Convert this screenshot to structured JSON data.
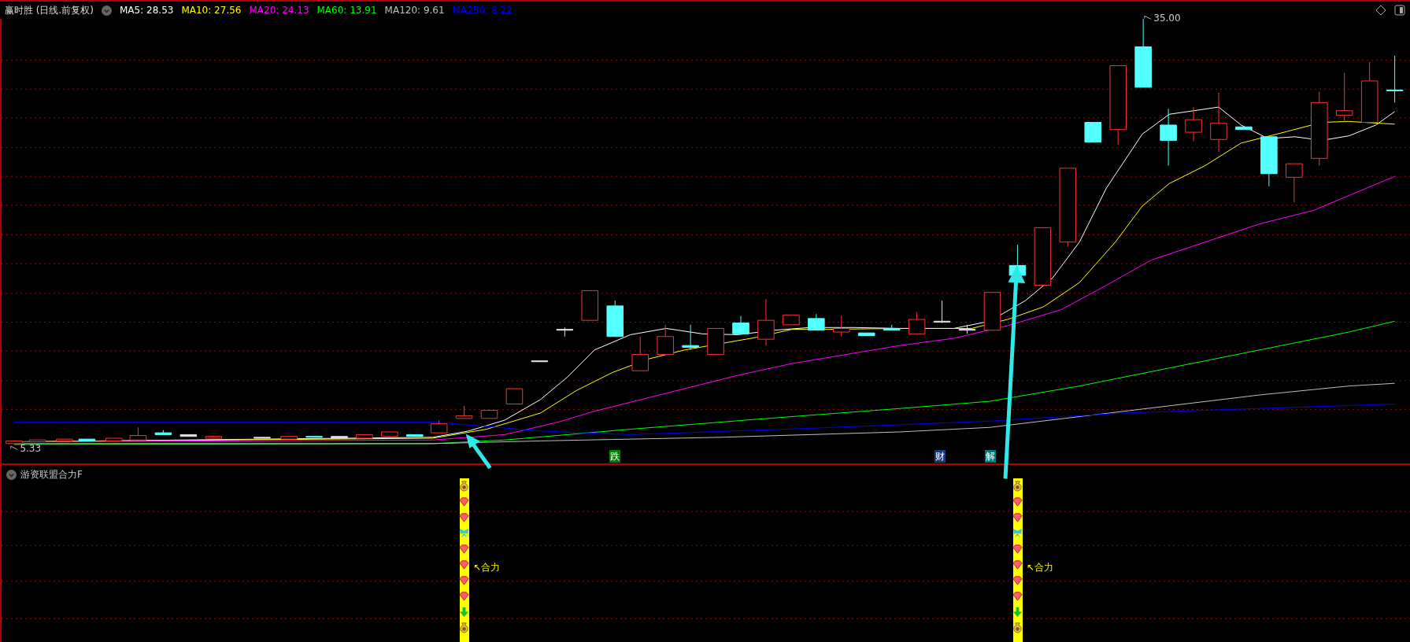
{
  "header": {
    "title": "赢时胜 (日线.前复权)",
    "ma": [
      {
        "label": "MA5: 28.53",
        "color": "#ffffff"
      },
      {
        "label": "MA10: 27.56",
        "color": "#ffff00"
      },
      {
        "label": "MA20: 24.13",
        "color": "#ff00ff"
      },
      {
        "label": "MA60: 13.91",
        "color": "#00ff00"
      },
      {
        "label": "MA120: 9.61",
        "color": "#c0c0c0"
      },
      {
        "label": "MA250: 8.22",
        "color": "#0000ff"
      }
    ]
  },
  "price_labels": {
    "high": "35.00",
    "low": "5.33"
  },
  "signals": [
    {
      "text": "跌",
      "color": "#008000"
    },
    {
      "text": "财",
      "color": "#1a3c78"
    },
    {
      "text": "解",
      "color": "#007878"
    }
  ],
  "indicator": {
    "title": "游资联盟合力F",
    "columns": [
      {
        "label": "↖合力"
      },
      {
        "label": "↖合力"
      }
    ]
  }
}
